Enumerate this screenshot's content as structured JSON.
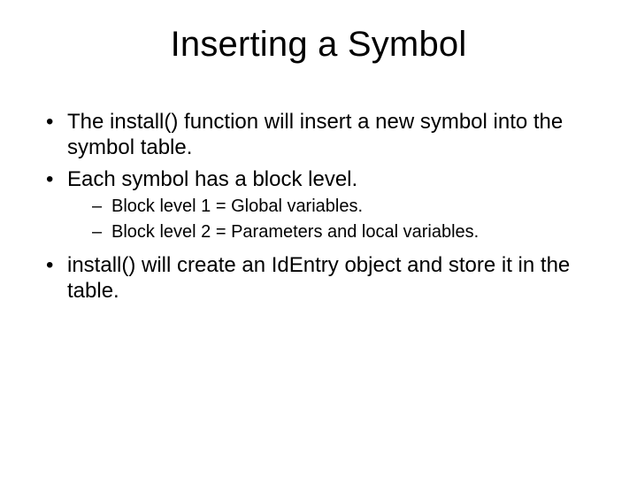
{
  "title": "Inserting a Symbol",
  "bullets": [
    {
      "text": "The install() function will insert a new symbol into the symbol table."
    },
    {
      "text": "Each symbol has a block level.",
      "sub": [
        "Block level 1 = Global variables.",
        "Block level 2 = Parameters and local variables."
      ]
    },
    {
      "text": "install() will create an IdEntry object and store it in the table."
    }
  ]
}
